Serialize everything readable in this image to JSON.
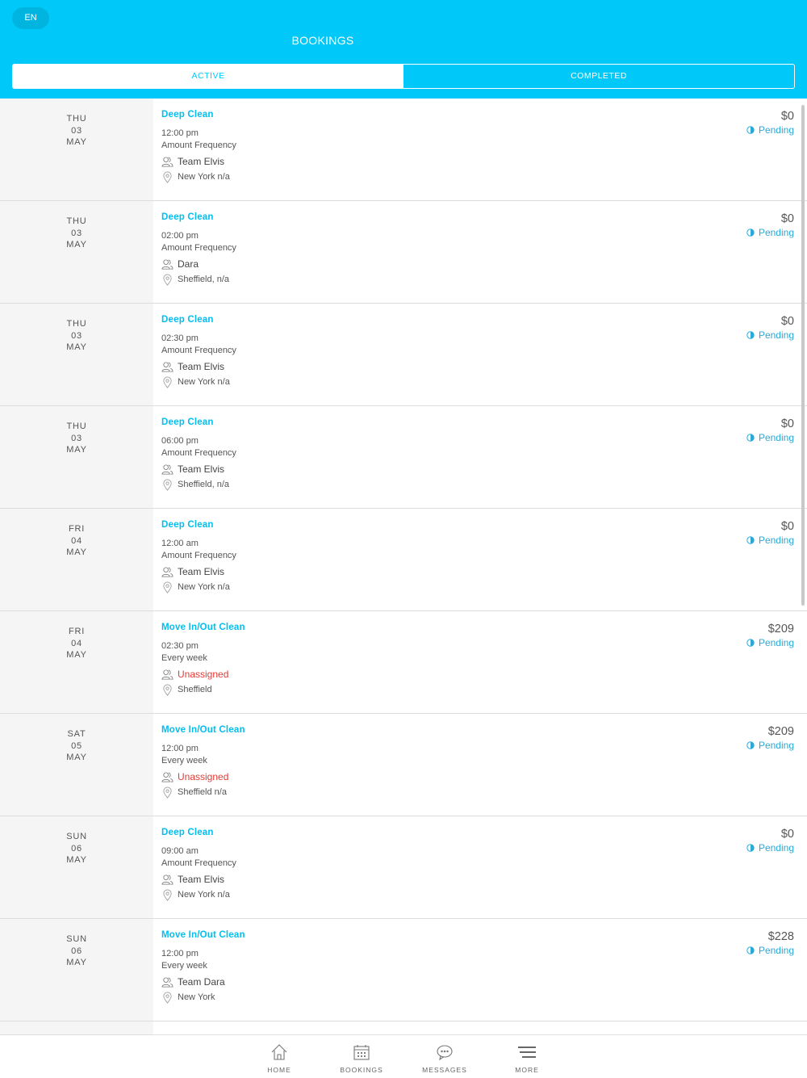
{
  "header": {
    "language": "EN",
    "title": "BOOKINGS",
    "tabs": [
      {
        "label": "ACTIVE",
        "selected": true
      },
      {
        "label": "COMPLETED",
        "selected": false
      }
    ]
  },
  "bookings": [
    {
      "day": "THU",
      "date": "03",
      "month": "MAY",
      "service": "Deep Clean",
      "time": "12:00 pm",
      "frequency": "Amount Frequency",
      "team": "Team Elvis",
      "location": "New York n/a",
      "price": "$0",
      "status": "Pending"
    },
    {
      "day": "THU",
      "date": "03",
      "month": "MAY",
      "service": "Deep Clean",
      "time": "02:00 pm",
      "frequency": "Amount Frequency",
      "team": "Dara",
      "location": "Sheffield, n/a",
      "price": "$0",
      "status": "Pending"
    },
    {
      "day": "THU",
      "date": "03",
      "month": "MAY",
      "service": "Deep Clean",
      "time": "02:30 pm",
      "frequency": "Amount Frequency",
      "team": "Team Elvis",
      "location": "New York n/a",
      "price": "$0",
      "status": "Pending"
    },
    {
      "day": "THU",
      "date": "03",
      "month": "MAY",
      "service": "Deep Clean",
      "time": "06:00 pm",
      "frequency": "Amount Frequency",
      "team": "Team Elvis",
      "location": "Sheffield, n/a",
      "price": "$0",
      "status": "Pending"
    },
    {
      "day": "FRI",
      "date": "04",
      "month": "MAY",
      "service": "Deep Clean",
      "time": "12:00 am",
      "frequency": "Amount Frequency",
      "team": "Team Elvis",
      "location": "New York n/a",
      "price": "$0",
      "status": "Pending"
    },
    {
      "day": "FRI",
      "date": "04",
      "month": "MAY",
      "service": "Move In/Out Clean",
      "time": "02:30 pm",
      "frequency": "Every week",
      "team": "Unassigned",
      "location": "Sheffield",
      "price": "$209",
      "status": "Pending"
    },
    {
      "day": "SAT",
      "date": "05",
      "month": "MAY",
      "service": "Move In/Out Clean",
      "time": "12:00 pm",
      "frequency": "Every week",
      "team": "Unassigned",
      "location": "Sheffield n/a",
      "price": "$209",
      "status": "Pending"
    },
    {
      "day": "SUN",
      "date": "06",
      "month": "MAY",
      "service": "Deep Clean",
      "time": "09:00 am",
      "frequency": "Amount Frequency",
      "team": "Team Elvis",
      "location": "New York n/a",
      "price": "$0",
      "status": "Pending"
    },
    {
      "day": "SUN",
      "date": "06",
      "month": "MAY",
      "service": "Move In/Out Clean",
      "time": "12:00 pm",
      "frequency": "Every week",
      "team": "Team Dara",
      "location": "New York",
      "price": "$228",
      "status": "Pending"
    }
  ],
  "tabbar": {
    "home": "HOME",
    "bookings": "BOOKINGS",
    "messages": "MESSAGES",
    "more": "MORE"
  },
  "colors": {
    "accent": "#00c8f8",
    "unassigned": "#e53935",
    "status": "#2aa8d8"
  }
}
